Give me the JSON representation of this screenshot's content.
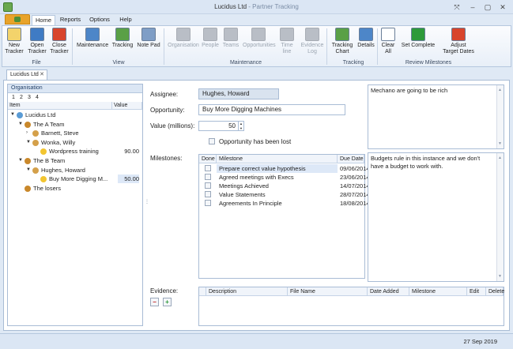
{
  "window": {
    "title": "Lucidus Ltd",
    "subtitle": "- Partner Tracking",
    "controls": [
      "⤧",
      "–",
      "▢",
      "✕"
    ]
  },
  "ribbon_tabs": [
    {
      "label": "Home",
      "active": true
    },
    {
      "label": "Reports",
      "active": false
    },
    {
      "label": "Options",
      "active": false
    },
    {
      "label": "Help",
      "active": false
    }
  ],
  "ribbon": {
    "groups": [
      {
        "label": "File",
        "buttons": [
          {
            "label": "New Tracker",
            "lines": [
              "New",
              "Tracker"
            ],
            "icon": "new-document-icon",
            "color": "#f3d36b"
          },
          {
            "label": "Open Tracker",
            "lines": [
              "Open",
              "Tracker"
            ],
            "icon": "open-tracker-icon",
            "color": "#3f7bc4"
          },
          {
            "label": "Close Tracker",
            "lines": [
              "Close",
              "Tracker"
            ],
            "icon": "close-tracker-icon",
            "color": "#d8452c"
          }
        ]
      },
      {
        "label": "View",
        "buttons": [
          {
            "label": "Maintenance",
            "lines": [
              "Maintenance"
            ],
            "icon": "maintenance-icon",
            "color": "#4d86c8"
          },
          {
            "label": "Tracking",
            "lines": [
              "Tracking"
            ],
            "icon": "tracking-icon",
            "color": "#5aa046"
          },
          {
            "label": "Note Pad",
            "lines": [
              "Note Pad"
            ],
            "icon": "notepad-icon",
            "color": "#7f9ec6"
          }
        ]
      },
      {
        "label": "Maintenance",
        "buttons": [
          {
            "label": "Organisation",
            "lines": [
              "Organisation"
            ],
            "icon": "organisation-icon",
            "color": "#b9bec6",
            "disabled": true
          },
          {
            "label": "People",
            "lines": [
              "People"
            ],
            "icon": "people-icon",
            "color": "#b9bec6",
            "disabled": true
          },
          {
            "label": "Teams",
            "lines": [
              "Teams"
            ],
            "icon": "teams-icon",
            "color": "#b9bec6",
            "disabled": true
          },
          {
            "label": "Opportunities",
            "lines": [
              "Opportunities"
            ],
            "icon": "opportunities-icon",
            "color": "#b9bec6",
            "disabled": true
          },
          {
            "label": "Time line",
            "lines": [
              "Time line"
            ],
            "icon": "timeline-icon",
            "color": "#b9bec6",
            "disabled": true
          },
          {
            "label": "Evidence Log",
            "lines": [
              "Evidence",
              "Log"
            ],
            "icon": "evidence-log-icon",
            "color": "#b9bec6",
            "disabled": true
          }
        ]
      },
      {
        "label": "Tracking",
        "buttons": [
          {
            "label": "Tracking Chart",
            "lines": [
              "Tracking",
              "Chart"
            ],
            "icon": "tracking-chart-icon",
            "color": "#5aa046"
          },
          {
            "label": "Details",
            "lines": [
              "Details"
            ],
            "icon": "details-icon",
            "color": "#4d86c8"
          }
        ]
      },
      {
        "label": "Review Milestones",
        "buttons": [
          {
            "label": "Clear All",
            "lines": [
              "Clear",
              "All"
            ],
            "icon": "checkbox-empty-icon",
            "color": "#ffffff"
          },
          {
            "label": "Set Complete",
            "lines": [
              "Set Complete"
            ],
            "icon": "checkmark-icon",
            "color": "#2e9a3a"
          },
          {
            "label": "Adjust Target Dates",
            "lines": [
              "Adjust",
              "Target Dates"
            ],
            "icon": "calendar-icon",
            "color": "#d8452c"
          }
        ]
      }
    ]
  },
  "doc_tab": {
    "label": "Lucidus Ltd",
    "close": "✕"
  },
  "org_pane": {
    "header": "Organisation",
    "levels": [
      "1",
      "2",
      "3",
      "4"
    ],
    "columns": [
      "Item",
      "Value"
    ],
    "tree": [
      {
        "label": "Lucidus Ltd",
        "value": "",
        "depth": 0,
        "expander": "▼",
        "icon": "organisation-icon"
      },
      {
        "label": "The A Team",
        "value": "",
        "depth": 1,
        "expander": "▼",
        "icon": "team-icon"
      },
      {
        "label": "Barnett, Steve",
        "value": "",
        "depth": 2,
        "expander": "›",
        "icon": "person-icon"
      },
      {
        "label": "Wonka, Willy",
        "value": "",
        "depth": 2,
        "expander": "▼",
        "icon": "person-icon"
      },
      {
        "label": "Wordpress training",
        "value": "90.00",
        "depth": 3,
        "expander": "",
        "icon": "opportunity-icon"
      },
      {
        "label": "The B Team",
        "value": "",
        "depth": 1,
        "expander": "▼",
        "icon": "team-icon"
      },
      {
        "label": "Hughes, Howard",
        "value": "",
        "depth": 2,
        "expander": "▼",
        "icon": "person-icon"
      },
      {
        "label": "Buy More Digging M...",
        "value": "50.00",
        "depth": 3,
        "expander": "",
        "icon": "opportunity-icon",
        "selected": true
      },
      {
        "label": "The losers",
        "value": "",
        "depth": 1,
        "expander": "",
        "icon": "team-icon"
      }
    ]
  },
  "form": {
    "assignee_label": "Assignee:",
    "assignee_value": "Hughes, Howard",
    "opportunity_label": "Opportunity:",
    "opportunity_value": "Buy More Digging Machines",
    "value_label": "Value (millions):",
    "value_value": "50",
    "lost_label": "Opportunity has been lost",
    "lost_checked": false,
    "milestones_label": "Milestones:",
    "evidence_label": "Evidence:"
  },
  "milestones": {
    "columns": [
      "Done",
      "Milestone",
      "Due Date"
    ],
    "rows": [
      {
        "done": false,
        "milestone": "Prepare correct value hypothesis",
        "due": "09/06/2014",
        "selected": true
      },
      {
        "done": false,
        "milestone": "Agreed meetings with Execs",
        "due": "23/06/2014"
      },
      {
        "done": false,
        "milestone": "Meetings Achieved",
        "due": "14/07/2014"
      },
      {
        "done": false,
        "milestone": "Value Statements",
        "due": "28/07/2014"
      },
      {
        "done": false,
        "milestone": "Agreements In Principle",
        "due": "18/08/2014"
      }
    ]
  },
  "notes": {
    "top": "Mechano are going to be rich",
    "bottom": "Budgets rule in this instance and we don't have a budget to work with."
  },
  "evidence": {
    "columns": [
      "Description",
      "File Name",
      "Date Added",
      "Milestone",
      "Edit",
      "Delete"
    ],
    "remove_symbol": "−",
    "add_symbol": "+"
  },
  "status": {
    "date": "27 Sep 2019"
  }
}
